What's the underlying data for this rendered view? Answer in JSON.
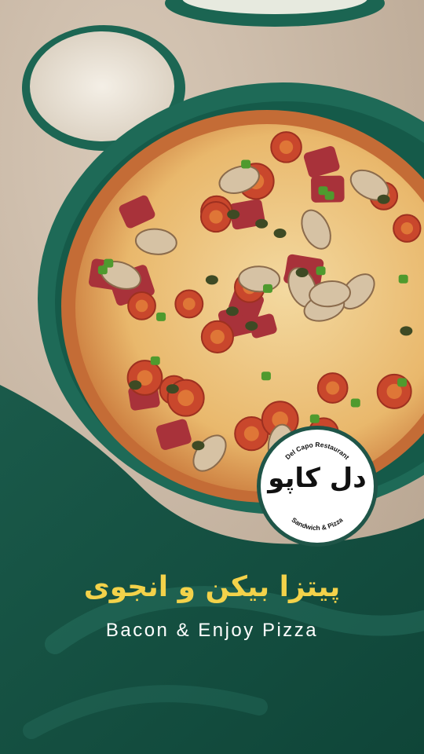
{
  "brand": {
    "restaurant_name_en": "Del Capo Restaurant",
    "restaurant_name_fa": "دل کاپو",
    "tagline": "Sandwich & Pizza",
    "logo_ring_color": "#1f5548"
  },
  "headline": {
    "title_fa": "پیتزا بیکن و انجوی",
    "title_en": "Bacon & Enjoy Pizza"
  },
  "colors": {
    "accent_yellow": "#f3d24a",
    "brand_green": "#1d5c4c",
    "plate_green": "#1f6a57",
    "table_wood": "#c9b8a6"
  }
}
